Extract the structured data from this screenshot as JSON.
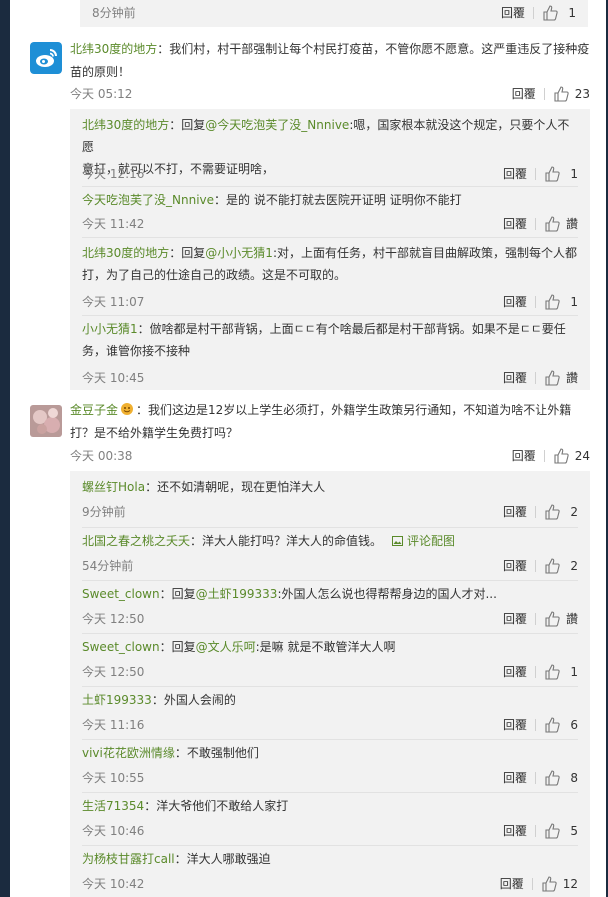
{
  "labels": {
    "reply": "回覆",
    "pic_comment": "评论配图"
  },
  "top_partial": {
    "time": "8分钟前",
    "likes": "1"
  },
  "comments": [
    {
      "user": "北纬30度的地方",
      "text_line1": "：我们村，村干部强制让每个村民打疫苗，不管你愿不愿意。这严重违反了接种疫",
      "text_line2": "苗的原则！",
      "time": "今天 05:12",
      "likes": "23",
      "avatar": "weibo-logo-avatar",
      "replies": [
        {
          "user": "北纬30度的地方",
          "prefix": "：回复",
          "mention": "@今天吃泡芙了没_Nnnive",
          "line1": ":嗯，国家根本就没这个规定，只要个人不愿",
          "line2": "意打，就可以不打，不需要证明啥，",
          "time": "今天 12:16",
          "likes": "1"
        },
        {
          "user": "今天吃泡芙了没_Nnnive",
          "prefix": "",
          "mention": "",
          "line1": "：是的  说不能打就去医院开证明 证明你不能打",
          "line2": "",
          "time": "今天 11:42",
          "likes": "讚"
        },
        {
          "user": "北纬30度的地方",
          "prefix": "：回复",
          "mention": "@小小无猜1",
          "line1": ":对，上面有任务，村干部就盲目曲解政策，强制每个人都",
          "line2": "打，为了自己的仕途自己的政绩。这是不可取的。",
          "time": "今天 11:07",
          "likes": "1"
        },
        {
          "user": "小小无猜1",
          "prefix": "",
          "mention": "",
          "line1": "：倣啥都是村干部背锅，上面ㄷㄷ有个啥最后都是村干部背锅。如果不是ㄷㄷ要任",
          "line2": "务，谁管你接不接种",
          "time": "今天 10:45",
          "likes": "讚"
        }
      ]
    },
    {
      "user": "金豆子金",
      "text_line1": "：我们这边是12岁以上学生必须打，外籍学生政策另行通知，不知道为啥不让外籍",
      "text_line2": "打？是不给外籍学生免费打吗？",
      "time": "今天 00:38",
      "likes": "24",
      "avatar": "flower-photo-avatar",
      "replies": [
        {
          "user": "螺丝钉Hola",
          "prefix": "",
          "mention": "",
          "line1": "：还不如清朝呢，现在更怕洋大人",
          "line2": "",
          "time": "9分钟前",
          "likes": "2"
        },
        {
          "user": "北国之春之桃之夭夭",
          "prefix": "",
          "mention": "",
          "line1": "：洋大人能打吗？洋大人的命值钱。",
          "line2": "",
          "time": "54分钟前",
          "likes": "2",
          "pic": true
        },
        {
          "user": "Sweet_clown",
          "prefix": "：回复",
          "mention": "@土虾199333",
          "line1": ":外国人怎么说也得帮帮身边的国人才对...",
          "line2": "",
          "time": "今天 12:50",
          "likes": "讚"
        },
        {
          "user": "Sweet_clown",
          "prefix": "：回复",
          "mention": "@文人乐呵",
          "line1": ":是嘛 就是不敢管洋大人啊",
          "line2": "",
          "time": "今天 12:50",
          "likes": "1"
        },
        {
          "user": "土虾199333",
          "prefix": "",
          "mention": "",
          "line1": "：外国人会闹的",
          "line2": "",
          "time": "今天 11:16",
          "likes": "6"
        },
        {
          "user": "vivi花花欧洲情缘",
          "prefix": "",
          "mention": "",
          "line1": "：不敢强制他们",
          "line2": "",
          "time": "今天 10:55",
          "likes": "8"
        },
        {
          "user": "生活71354",
          "prefix": "",
          "mention": "",
          "line1": "：洋大爷他们不敢给人家打",
          "line2": "",
          "time": "今天 10:46",
          "likes": "5"
        },
        {
          "user": "为杨枝甘露打call",
          "prefix": "",
          "mention": "",
          "line1": "：洋大人哪敢强迫",
          "line2": "",
          "time": "今天 10:42",
          "likes": "12"
        }
      ]
    }
  ],
  "colors": {
    "link": "#5a8a2a",
    "box_bg": "#f2f2f2",
    "side_bar": "#1b2b3f"
  }
}
